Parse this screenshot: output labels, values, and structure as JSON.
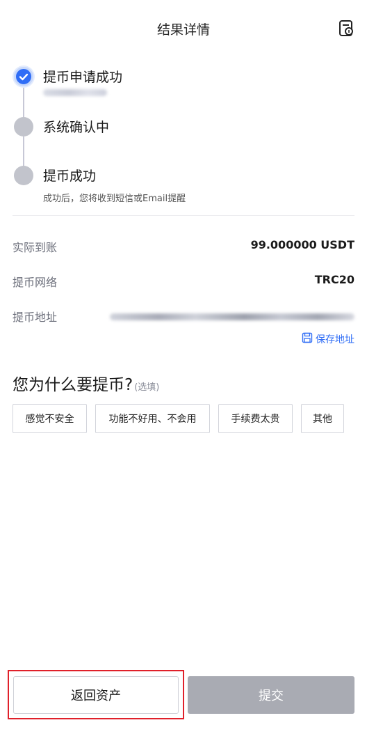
{
  "header": {
    "title": "结果详情",
    "icon": "receipt-icon"
  },
  "steps": [
    {
      "title": "提币申请成功",
      "status": "done",
      "subtitle": ""
    },
    {
      "title": "系统确认中",
      "status": "pending",
      "subtitle": ""
    },
    {
      "title": "提币成功",
      "status": "pending",
      "subtitle": "成功后，您将收到短信或Email提醒"
    }
  ],
  "details": {
    "received_label": "实际到账",
    "received_value": "99.000000 USDT",
    "network_label": "提币网络",
    "network_value": "TRC20",
    "address_label": "提币地址"
  },
  "save_address": {
    "label": "保存地址",
    "icon": "save-icon"
  },
  "reason": {
    "question": "您为什么要提币?",
    "optional": "(选填)",
    "options": [
      "感觉不安全",
      "功能不好用、不会用",
      "手续费太贵",
      "其他"
    ]
  },
  "footer": {
    "back_label": "返回资产",
    "submit_label": "提交"
  },
  "colors": {
    "accent": "#2f6df6",
    "pending_dot": "#c2c4cc",
    "submit_disabled": "#a9abb3",
    "highlight": "#e0202a"
  }
}
